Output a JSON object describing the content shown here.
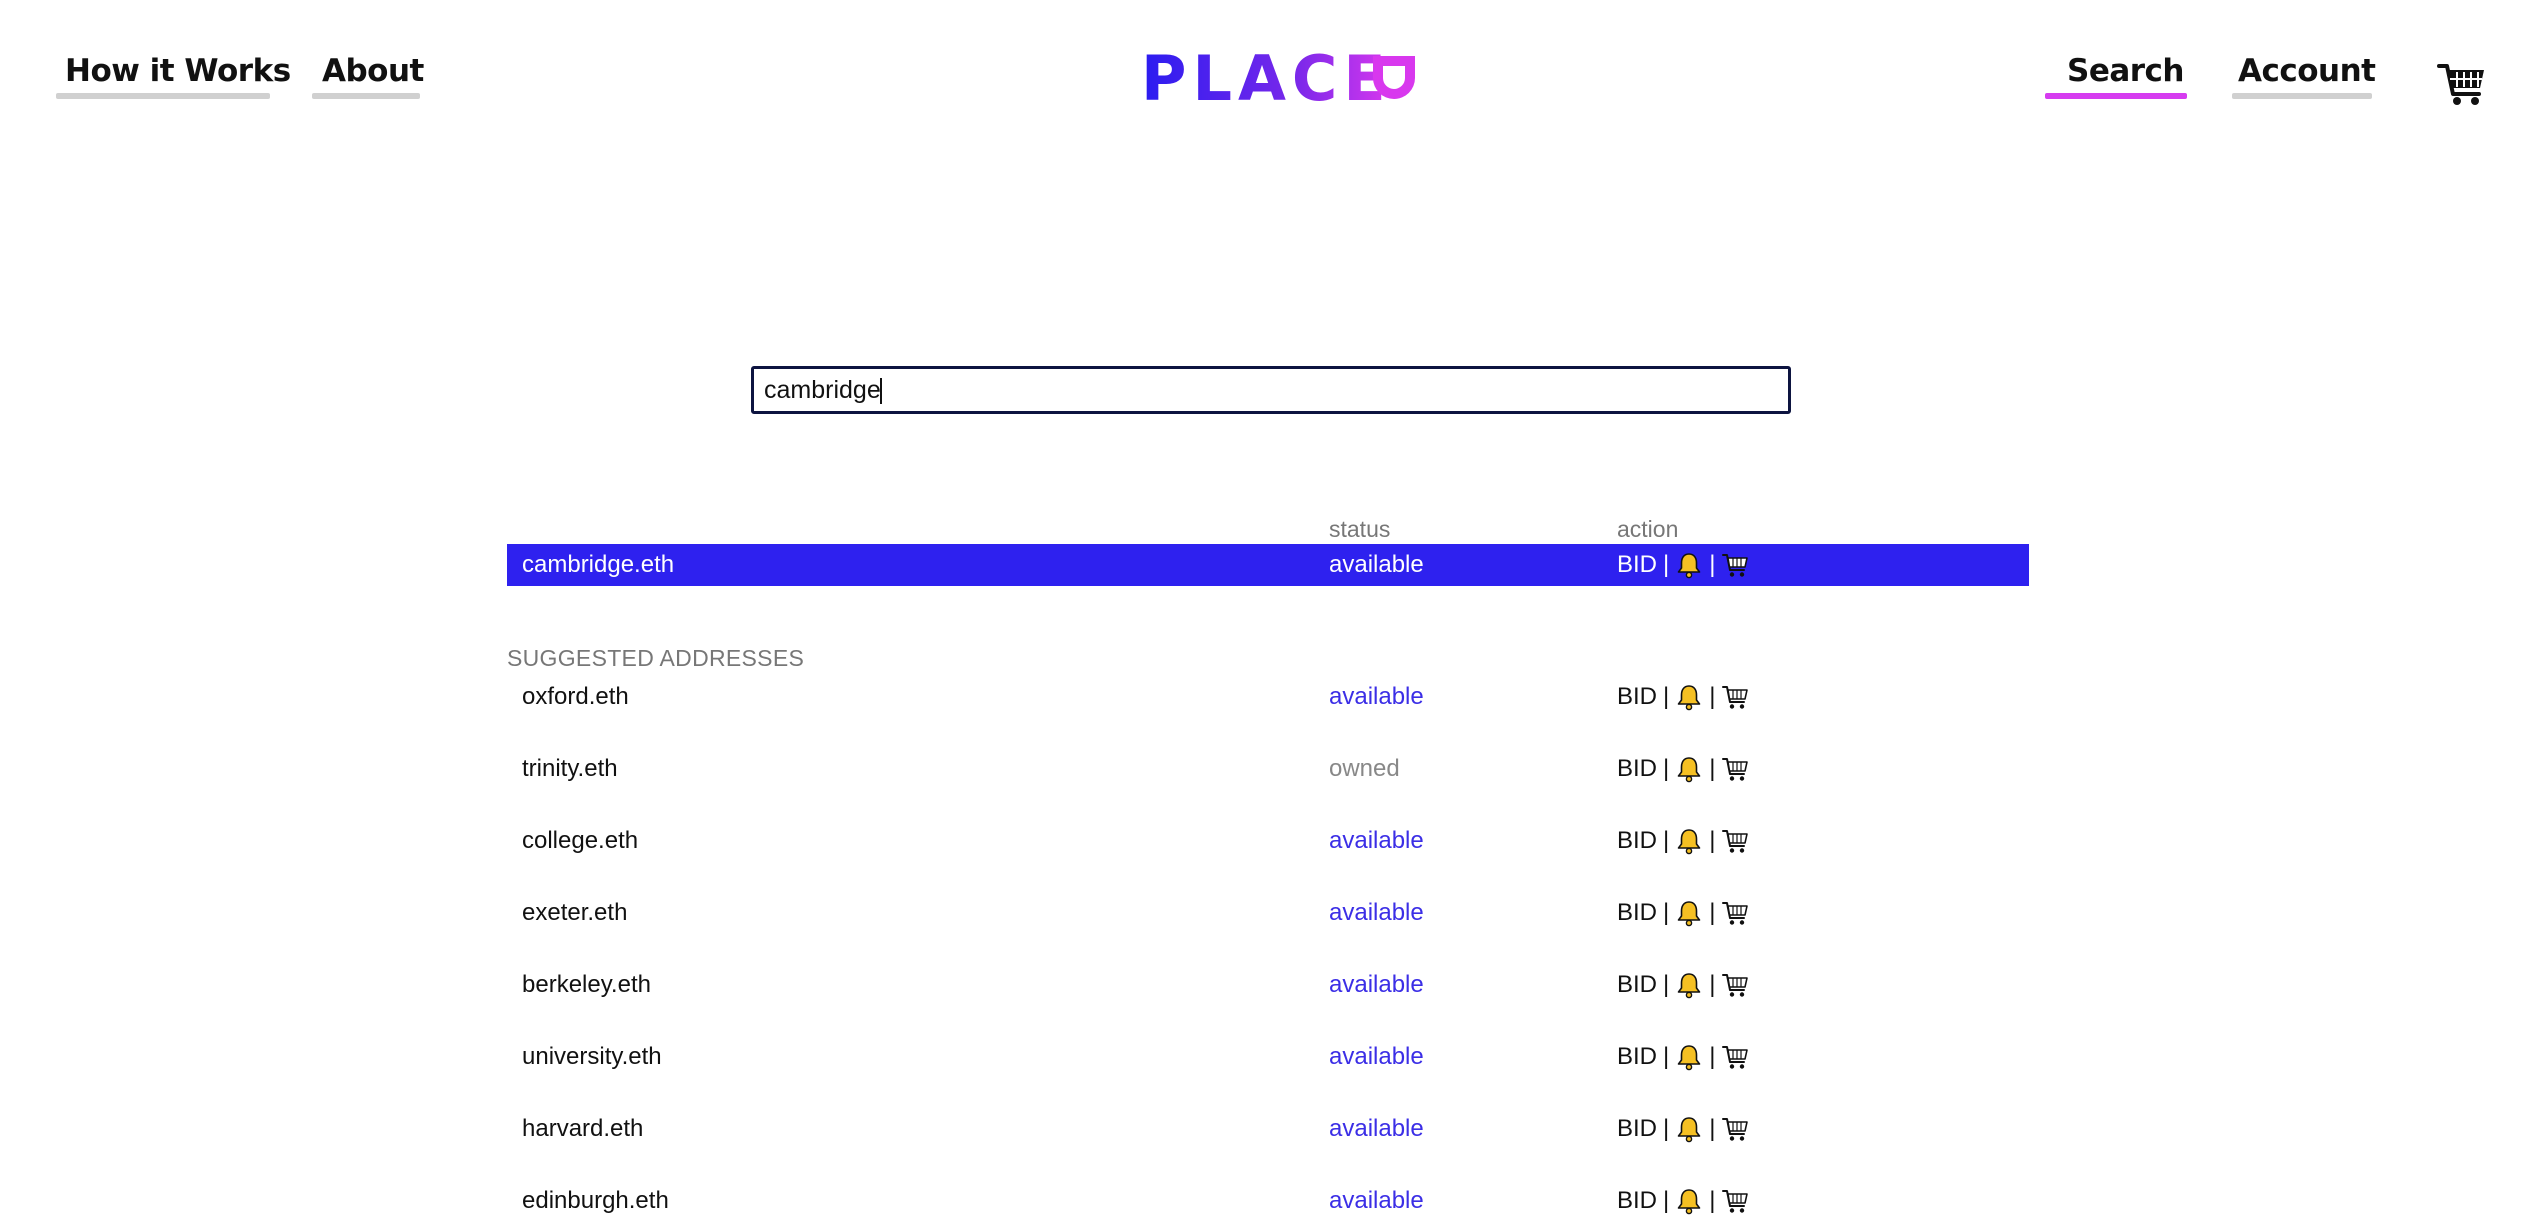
{
  "header": {
    "nav_left": [
      {
        "label": "How it Works"
      },
      {
        "label": "About"
      }
    ],
    "logo_text": "PLACE",
    "nav_right": [
      {
        "label": "Search",
        "active": true
      },
      {
        "label": "Account",
        "active": false
      }
    ],
    "cart_icon": "cart-icon"
  },
  "search": {
    "value": "cambridge",
    "placeholder": ""
  },
  "columns": {
    "status": "status",
    "action": "action"
  },
  "primary_result": {
    "name": "cambridge.eth",
    "status": "available",
    "action": {
      "bid": "BID",
      "sep": "|"
    }
  },
  "suggested_title": "SUGGESTED ADDRESSES",
  "suggestions": [
    {
      "name": "oxford.eth",
      "status": "available"
    },
    {
      "name": "trinity.eth",
      "status": "owned"
    },
    {
      "name": "college.eth",
      "status": "available"
    },
    {
      "name": "exeter.eth",
      "status": "available"
    },
    {
      "name": "berkeley.eth",
      "status": "available"
    },
    {
      "name": "university.eth",
      "status": "available"
    },
    {
      "name": "harvard.eth",
      "status": "available"
    },
    {
      "name": "edinburgh.eth",
      "status": "available"
    }
  ],
  "action_labels": {
    "bid": "BID",
    "sep": "|"
  },
  "colors": {
    "accent_blue": "#2e21ef",
    "accent_magenta": "#d63cf0",
    "available_text": "#3b2ee6",
    "owned_text": "#888888",
    "underline_inactive": "#d0d0d0"
  },
  "icons": [
    "bell-icon",
    "shopping-cart-icon"
  ]
}
